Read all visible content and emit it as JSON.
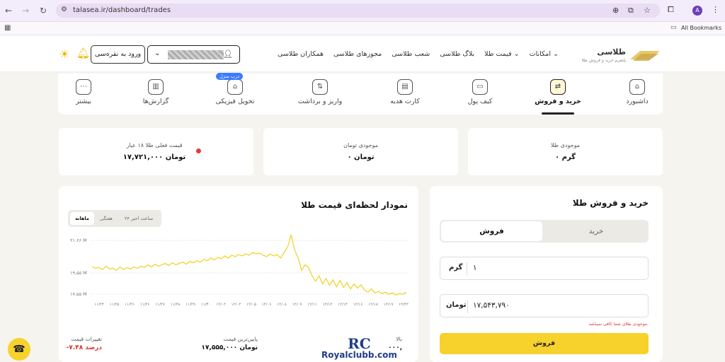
{
  "browser": {
    "url": "talasea.ir/dashboard/trades",
    "bookmarks_label": "All Bookmarks",
    "avatar_letter": "A"
  },
  "header": {
    "brand_name": "طلاسی",
    "brand_tagline": "پلتفرم خرید و فروش طلا",
    "menu": [
      "امکانات",
      "قیمت طلا",
      "بلاگ طلاسی",
      "شعب طلاسی",
      "مجوزهای طلاسی",
      "همکاران طلاسی"
    ],
    "login_label": "ورود به نقره‌سی"
  },
  "tabs": [
    "داشبورد",
    "خرید و فروش",
    "کیف پول",
    "کارت هدیه",
    "واریز و برداشت",
    "تحویل فیزیکی",
    "گزارش‌ها",
    "بیشتر"
  ],
  "tab_badge": "درب منزل",
  "cards": {
    "gold_label": "موجودی طلا",
    "gold_value": "۰ گرم",
    "toman_label": "موجودی تومان",
    "toman_value": "۰ تومان",
    "price_label": "قیمت فعلی طلا ۱۸ عیار",
    "price_value": "۱۷,۷۲۱,۰۰۰ تومان"
  },
  "trade": {
    "title": "خرید و فروش طلا",
    "sell_tab": "فروش",
    "buy_tab": "خرید",
    "gram_unit": "گرم",
    "gram_value": "۱",
    "toman_unit": "تومان",
    "toman_value": "۱۷,۵۴۳,۷۹۰",
    "error": "موجودی طلای شما کافی نمیباشد.",
    "submit": "فروش"
  },
  "chart_panel": {
    "title": "نمودار لحظه‌ای قیمت طلا",
    "ranges": [
      "۲۴ ساعت اخیر",
      "هفتگی",
      "ماهانه"
    ],
    "selected_range": "ماهانه",
    "stat_high_label": "بالا",
    "stat_high_value": "۰۰۰,",
    "stat_low_label": "پایین‌ترین قیمت",
    "stat_low_value": "۱۷,۵۵۵,۰۰۰ تومان",
    "stat_change_label": "تغییرات قیمت",
    "stat_change_value": "-۷.۴۸ درصد"
  },
  "watermark": {
    "logo": "RC",
    "url": "Royalclubb.com"
  },
  "chart_data": {
    "type": "line",
    "title": "نمودار لحظه‌ای قیمت طلا",
    "y_ticks": [
      "۲۱.۶۶ M",
      "۱۹.۵۵ M",
      "۱۷.۵۵ M"
    ],
    "ylim": [
      17.2,
      22.0
    ],
    "x_ticks": [
      "۱۱/۲۴",
      "۱۱/۲۵",
      "۱۱/۲۶",
      "۱۱/۲۶",
      "۱۱/۲۷",
      "۱۱/۲۸",
      "۱۱/۲۹",
      "۱۱/۳۰",
      "۱۲/۰۲",
      "۱۲/۰۴",
      "۱۲/۰۵",
      "۱۲/۰۶",
      "۱۲/۰۸",
      "۱۲/۰۹",
      "۱۲/۱۱",
      "۱۲/۱۲",
      "۱۲/۱۴",
      "۱۲/۱۶",
      "۱۲/۱۸",
      "۱۲/۱۹",
      "۱۲/۲۲"
    ],
    "values": [
      19.55,
      19.45,
      19.5,
      19.35,
      19.6,
      19.4,
      19.45,
      19.3,
      19.55,
      19.35,
      19.5,
      19.4,
      19.55,
      19.45,
      19.6,
      19.5,
      19.7,
      19.55,
      19.75,
      19.6,
      19.7,
      19.8,
      19.65,
      19.85,
      19.7,
      19.8,
      19.9,
      19.75,
      19.95,
      19.85,
      20.0,
      19.9,
      20.1,
      20.0,
      20.2,
      20.05,
      20.25,
      20.15,
      20.35,
      20.2,
      20.4,
      20.3,
      20.45,
      20.35,
      20.5,
      20.4,
      20.6,
      20.5,
      20.55,
      20.4,
      20.3,
      20.5,
      20.35,
      20.45,
      20.2,
      20.6,
      21.0,
      21.9,
      20.8,
      20.2,
      19.3,
      19.7,
      19.5,
      18.9,
      18.5,
      18.9,
      18.3,
      18.7,
      18.2,
      18.6,
      18.1,
      18.55,
      18.05,
      18.4,
      17.95,
      18.3,
      18.0,
      18.25,
      17.85,
      17.7,
      17.95,
      17.65,
      17.75,
      17.6,
      17.7,
      17.55,
      17.65,
      17.5,
      17.6,
      17.55,
      17.7
    ]
  }
}
